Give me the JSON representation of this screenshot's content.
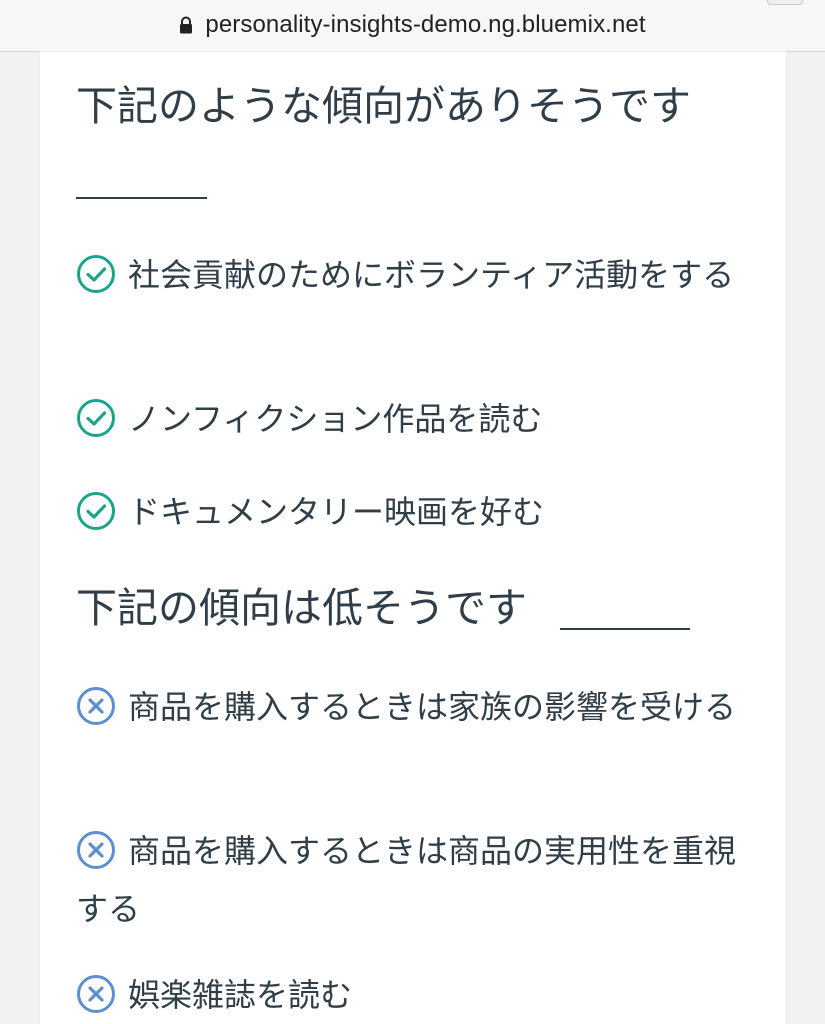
{
  "browser": {
    "url": "personality-insights-demo.ng.bluemix.net",
    "lock_icon": "lock-icon"
  },
  "colors": {
    "check": "#1aa58a",
    "cross": "#5b8fd1",
    "text": "#2f3e48"
  },
  "likely": {
    "heading": "下記のような傾向がありそうです",
    "icon": "check-circle-icon",
    "items": [
      {
        "label": "社会貢献のためにボランティア活動をする"
      },
      {
        "label": "ノンフィクション作品を読む"
      },
      {
        "label": "ドキュメンタリー映画を好む"
      }
    ]
  },
  "unlikely": {
    "heading": "下記の傾向は低そうです",
    "icon": "x-circle-icon",
    "items": [
      {
        "label": "商品を購入するときは家族の影響を受ける"
      },
      {
        "label": "商品を購入するときは商品の実用性を重視する"
      },
      {
        "label": "娯楽雑誌を読む"
      }
    ]
  }
}
